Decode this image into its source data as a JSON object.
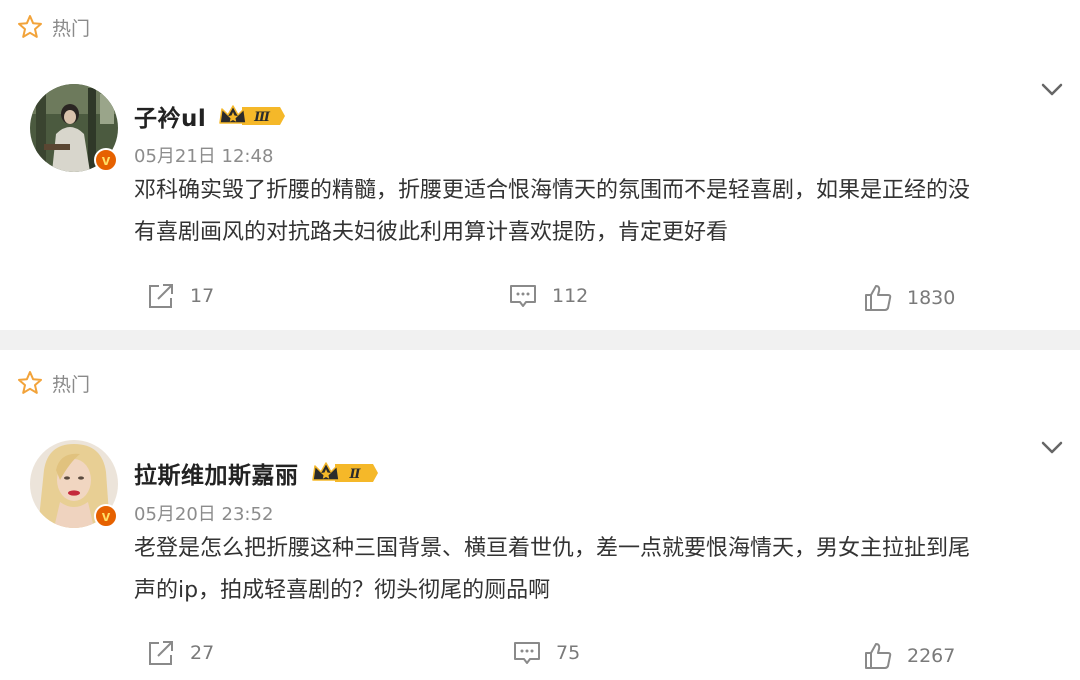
{
  "posts": [
    {
      "hot_label": "热门",
      "username": "子衿ul",
      "vip_level": "Ⅲ",
      "timestamp": "05月21日 12:48",
      "content_line1": "邓科确实毁了折腰的精髓，折腰更适合恨海情天的氛围而不是轻喜剧，如果是正经的没",
      "content_line2": "有喜剧画风的对抗路夫妇彼此利用算计喜欢提防，肯定更好看",
      "shares": "17",
      "comments": "112",
      "likes": "1830",
      "verified_mark": "v"
    },
    {
      "hot_label": "热门",
      "username": "拉斯维加斯嘉丽",
      "vip_level": "Ⅱ",
      "timestamp": "05月20日 23:52",
      "content_line1": "老登是怎么把折腰这种三国背景、横亘着世仇，差一点就要恨海情天，男女主拉扯到尾",
      "content_line2": "声的ip，拍成轻喜剧的？彻头彻尾的厕品啊",
      "shares": "27",
      "comments": "75",
      "likes": "2267",
      "verified_mark": "v"
    }
  ],
  "icons": {
    "hot": "star-outline-icon",
    "collapse": "chevron-down-icon",
    "share": "share-icon",
    "comment": "comment-icon",
    "like": "thumbs-up-icon",
    "verified": "verified-badge-icon",
    "vip": "vip-crown-badge"
  },
  "colors": {
    "star": "#f2a33a",
    "verified_badge": "#e66100",
    "vip_gold": "#f5b829",
    "vip_dark": "#2b2b2b",
    "icon_gray": "#8a8a8a",
    "separator": "#f1f1f1"
  }
}
